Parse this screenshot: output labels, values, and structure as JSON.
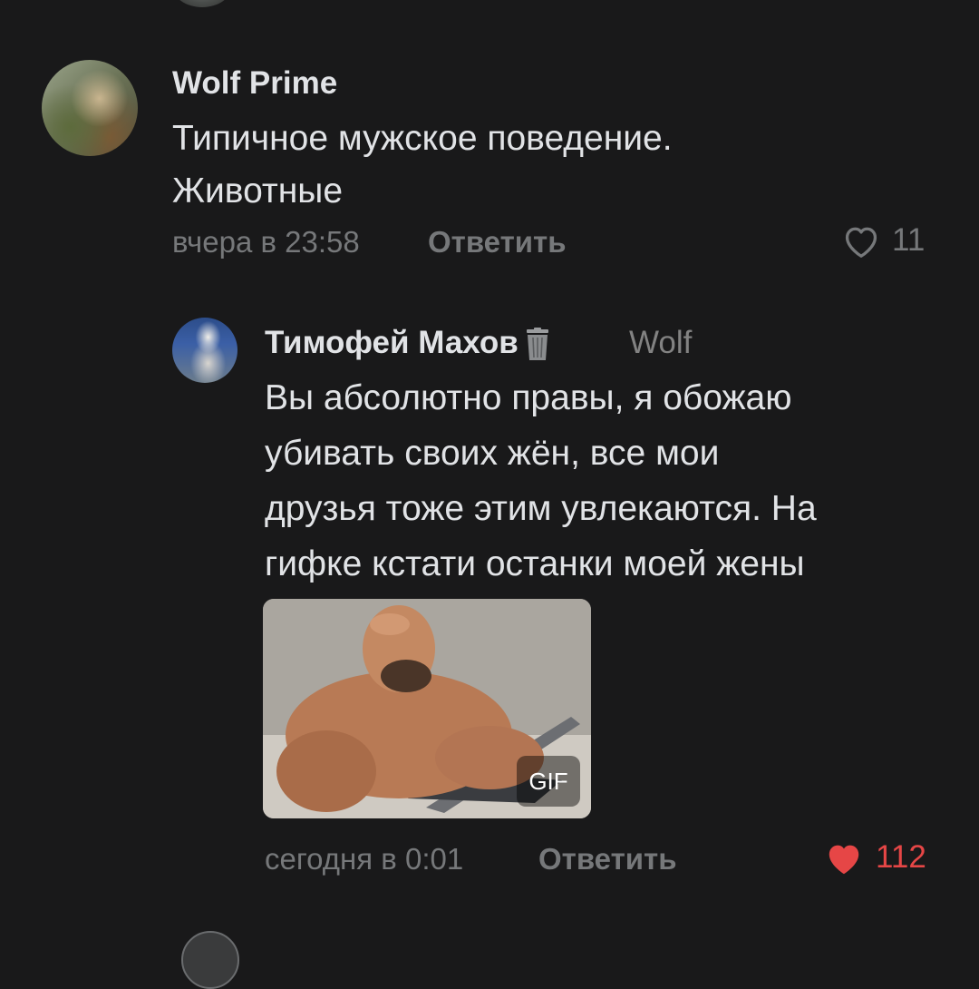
{
  "comment": {
    "author": "Wolf Prime",
    "text_lines": [
      "Типичное мужское поведение.",
      "Животные"
    ],
    "timestamp": "вчера в 23:58",
    "reply_label": "Ответить",
    "likes": "11",
    "liked": false
  },
  "reply": {
    "author": "Тимофей Махов",
    "reply_to": "Wolf",
    "text_lines": [
      "Вы абсолютно правы, я обожаю",
      "убивать своих жён, все мои",
      "друзья тоже этим увлекаются. На",
      "гифке кстати останки моей жены"
    ],
    "gif_badge": "GIF",
    "timestamp": "сегодня в 0:01",
    "reply_label": "Ответить",
    "likes": "112",
    "liked": true
  },
  "colors": {
    "background": "#19191a",
    "text": "#e1e3e6",
    "secondary": "#76787a",
    "like_active": "#e64646"
  },
  "icons": [
    "heart-outline-icon",
    "heart-filled-icon",
    "trash-icon"
  ]
}
